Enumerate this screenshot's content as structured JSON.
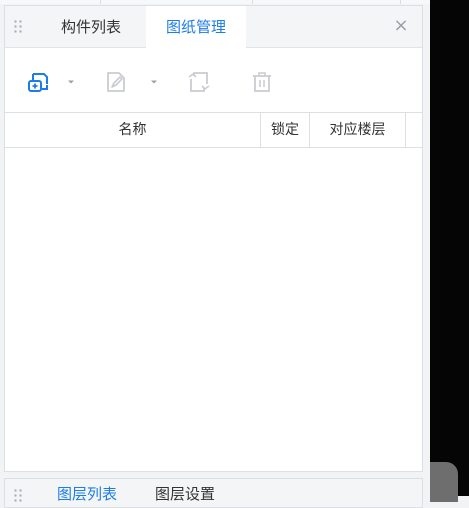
{
  "tabs": [
    {
      "label": "构件列表",
      "active": false
    },
    {
      "label": "图纸管理",
      "active": true
    }
  ],
  "close_glyph": "×",
  "toolbar": {
    "icons": [
      "add-drawing-icon",
      "edit-drawing-icon",
      "rotate-drawing-icon",
      "delete-icon"
    ],
    "dropdown_caret": "caret-down-icon"
  },
  "table": {
    "columns": [
      "名称",
      "锁定",
      "对应楼层"
    ],
    "rows": []
  },
  "bottom_tabs": [
    {
      "label": "图层列表",
      "active": true
    },
    {
      "label": "图层设置",
      "active": false
    }
  ],
  "colors": {
    "accent": "#1d7ce8",
    "panel_bg": "#ffffff",
    "tabbar_bg": "#f4f5f7",
    "border": "#dcdfe4"
  }
}
